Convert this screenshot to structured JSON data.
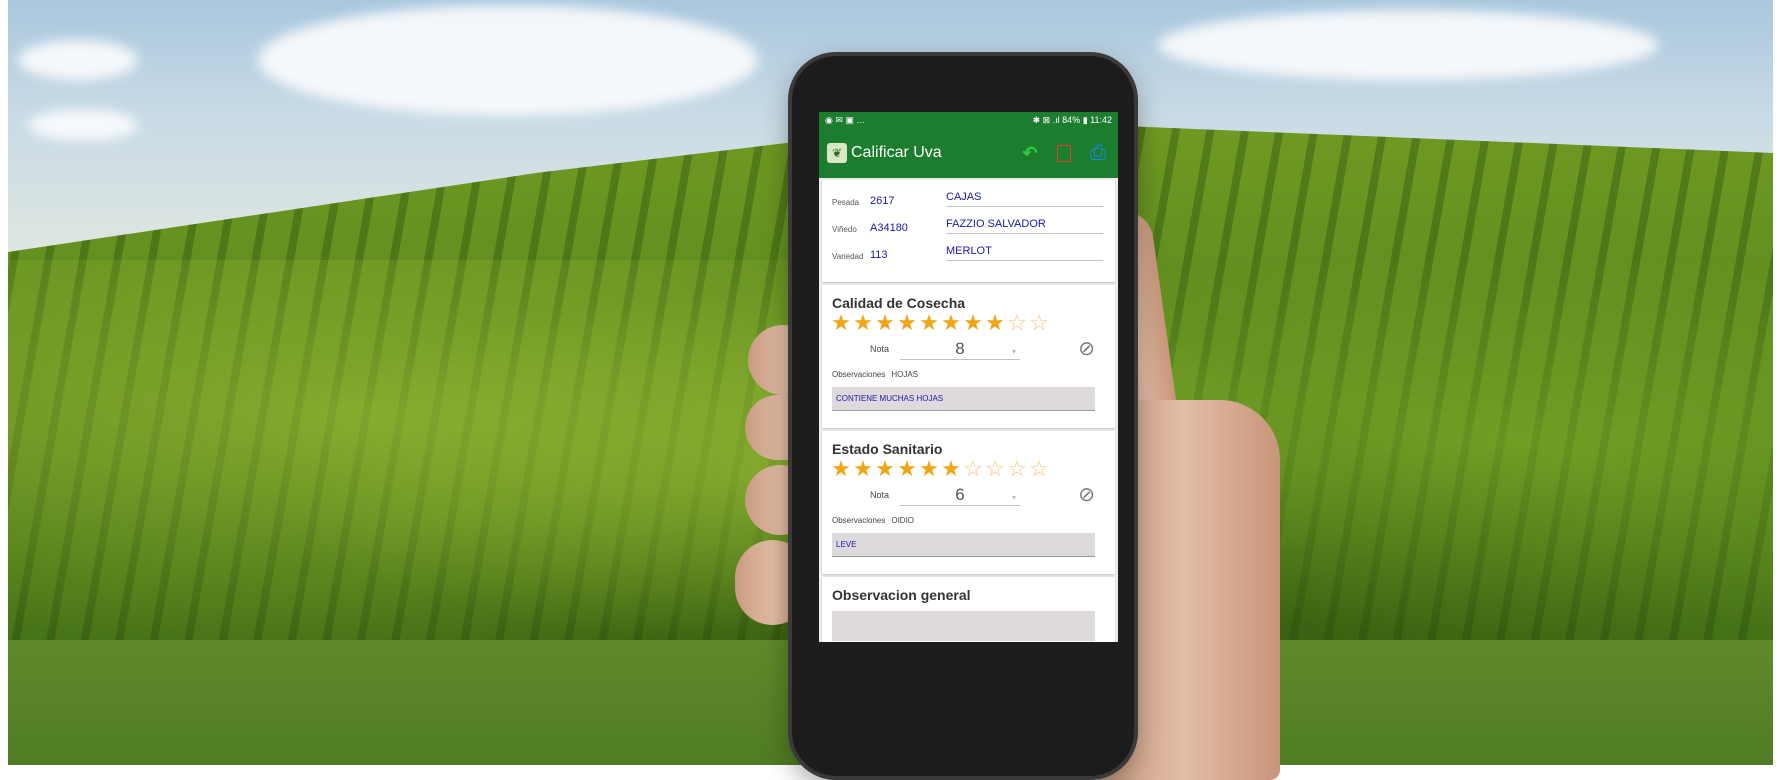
{
  "status": {
    "left_icons": "◉ ✉ ▣ …",
    "right_text": "✱ ⊠ .ıl 84% ▮ 11:42"
  },
  "app": {
    "title": "Calificar Uva",
    "logo_icon": "grape-logo-icon",
    "actions": [
      {
        "name": "undo-icon",
        "glyph": "↶",
        "color": "#2ecc40"
      },
      {
        "name": "pdf-icon",
        "glyph": "▣",
        "color": "#e53935"
      },
      {
        "name": "print-icon",
        "glyph": "⎙",
        "color": "#1e88e5"
      }
    ]
  },
  "info": {
    "rows": [
      {
        "label": "Pesada",
        "value": "2617",
        "detail": "CAJAS"
      },
      {
        "label": "Viñedo",
        "value": "A34180",
        "detail": "FAZZIO SALVADOR"
      },
      {
        "label": "Variedad",
        "value": "113",
        "detail": "MERLOT"
      }
    ]
  },
  "sections": [
    {
      "title": "Calidad de Cosecha",
      "rating": 8,
      "max_rating": 10,
      "nota_label": "Nota",
      "nota_value": "8",
      "obs_label": "Observaciones",
      "obs_value": "HOJAS",
      "obs_text": "CONTIENE MUCHAS HOJAS"
    },
    {
      "title": "Estado Sanitario",
      "rating": 6,
      "max_rating": 10,
      "nota_label": "Nota",
      "nota_value": "6",
      "obs_label": "Observaciones",
      "obs_value": "OIDIO",
      "obs_text": "LEVE"
    }
  ],
  "general": {
    "title": "Observacion general"
  },
  "colors": {
    "appbar": "#1c7d2e",
    "star": "#f0a514",
    "value_text": "#1a1aa6"
  }
}
